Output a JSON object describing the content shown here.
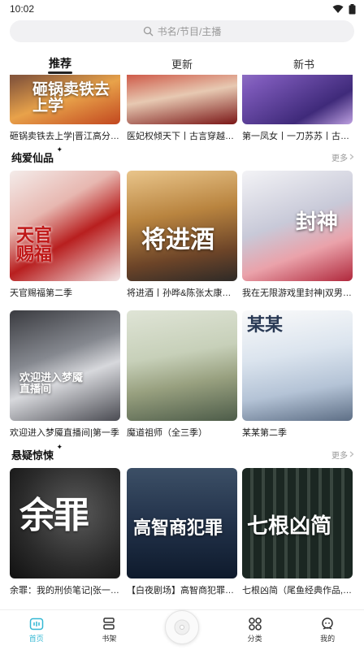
{
  "status_bar": {
    "time": "10:02"
  },
  "search": {
    "placeholder": "书名/节目/主播"
  },
  "tabs": [
    {
      "label": "推荐",
      "active": true
    },
    {
      "label": "更新",
      "active": false
    },
    {
      "label": "新书",
      "active": false
    }
  ],
  "top_row": [
    {
      "title": "砸锅卖铁去上学|晋江高分…",
      "cover_text": "砸锅卖铁去上学"
    },
    {
      "title": "医妃权倾天下丨古言穿越…",
      "cover_text": ""
    },
    {
      "title": "第一凤女丨一刀苏苏丨古言…",
      "cover_text": ""
    }
  ],
  "sections": [
    {
      "title": "纯爱仙品",
      "more": "更多",
      "items": [
        {
          "title": "天官赐福第二季",
          "cover_text": "天官赐福"
        },
        {
          "title": "将进酒丨孙晔&陈张太康领…",
          "cover_text": "将进酒"
        },
        {
          "title": "我在无限游戏里封神|双男…",
          "cover_text": "封神"
        },
        {
          "title": "欢迎进入梦魇直播间|第一季",
          "cover_text": "欢迎进入梦魇直播间"
        },
        {
          "title": "魔道祖师（全三季）",
          "cover_text": ""
        },
        {
          "title": "某某第二季",
          "cover_text": "某某"
        }
      ]
    },
    {
      "title": "悬疑惊悚",
      "more": "更多",
      "items": [
        {
          "title": "余罪：我的刑侦笔记|张一…",
          "cover_text": "余罪"
        },
        {
          "title": "【白夜剧场】高智商犯罪丨…",
          "cover_text": "高智商犯罪"
        },
        {
          "title": "七根凶简（尾鱼经典作品,…",
          "cover_text": "七根凶简"
        }
      ]
    }
  ],
  "bottom_nav": [
    {
      "label": "首页",
      "icon": "home-icon",
      "active": true
    },
    {
      "label": "书架",
      "icon": "bookshelf-icon",
      "active": false
    },
    {
      "label": "分类",
      "icon": "category-icon",
      "active": false
    },
    {
      "label": "我的",
      "icon": "profile-icon",
      "active": false
    }
  ],
  "colors": {
    "accent": "#34b8d4",
    "section_highlight": "#bfe9f2"
  }
}
